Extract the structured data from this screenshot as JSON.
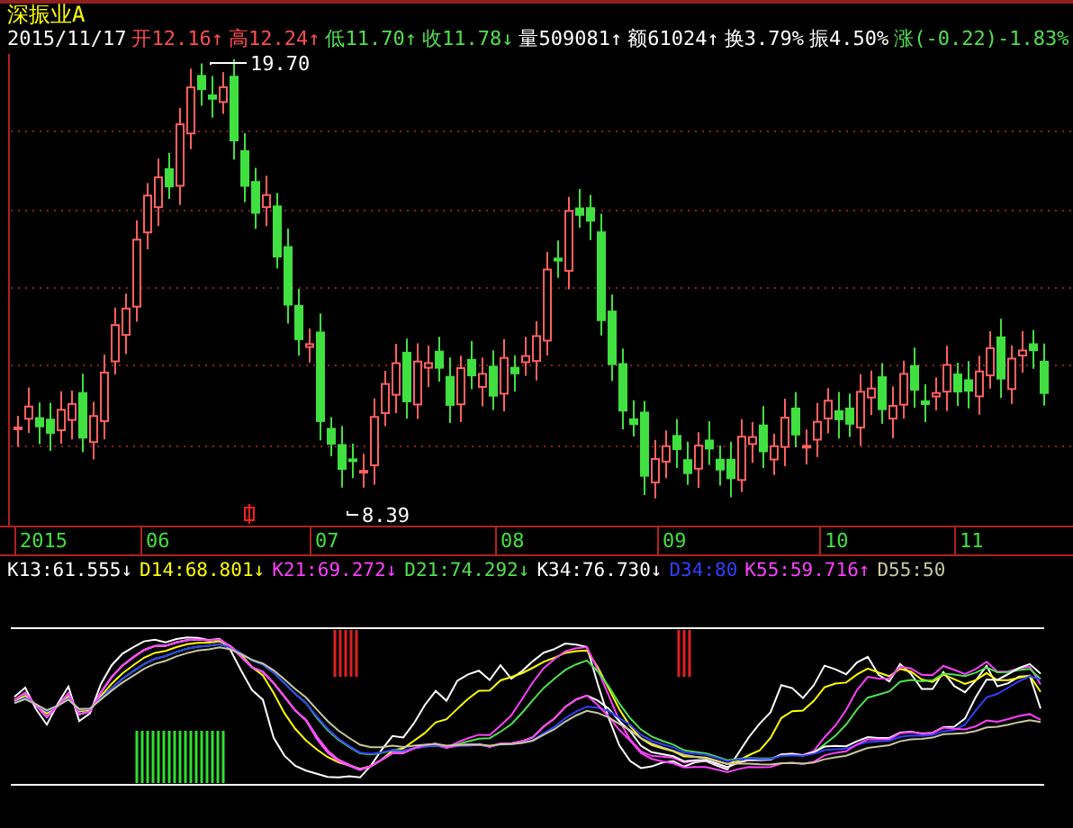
{
  "header": {
    "stock_name": "深振业A",
    "date": "2015/11/17",
    "quotes": [
      {
        "text": "开12.16",
        "arrow": "↑",
        "color": "#ff5050"
      },
      {
        "text": "高12.24",
        "arrow": "↑",
        "color": "#ff5050"
      },
      {
        "text": "低11.70",
        "arrow": "↑",
        "color": "#50e050"
      },
      {
        "text": "收11.78",
        "arrow": "↓",
        "color": "#50e050"
      },
      {
        "text": "量509081",
        "arrow": "↑",
        "color": "#ffffff"
      },
      {
        "text": "额61024",
        "arrow": "↑",
        "color": "#ffffff"
      },
      {
        "text": "换3.79%",
        "color": "#ffffff"
      },
      {
        "text": "振4.50%",
        "color": "#ffffff"
      },
      {
        "text": "涨(-0.22)-1.83%",
        "color": "#50e050"
      }
    ]
  },
  "price_chart": {
    "high_label": "19.70",
    "low_label": "8.39"
  },
  "time_axis": [
    "2015",
    "06",
    "07",
    "08",
    "09",
    "10",
    "11"
  ],
  "indicator_legend": [
    {
      "text": "K13:61.555",
      "arrow": "↓",
      "color": "#ffffff"
    },
    {
      "text": "D14:68.801",
      "arrow": "↓",
      "color": "#ffff00"
    },
    {
      "text": "K21:69.272",
      "arrow": "↓",
      "color": "#ff40ff"
    },
    {
      "text": "D21:74.292",
      "arrow": "↓",
      "color": "#50e050"
    },
    {
      "text": "K34:76.730",
      "arrow": "↓",
      "color": "#ffffff"
    },
    {
      "text": "D34:80",
      "color": "#3040ff"
    },
    {
      "text": "K55:59.716",
      "arrow": "↑",
      "color": "#ff40ff"
    },
    {
      "text": "D55:50",
      "color": "#c8c8a0"
    }
  ]
}
